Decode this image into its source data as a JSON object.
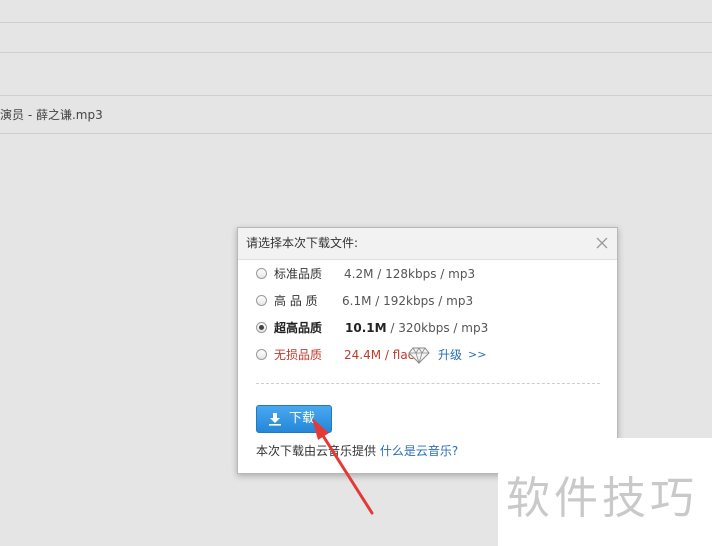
{
  "background": {
    "file_name": "演员 - 薛之谦.mp3"
  },
  "dialog": {
    "title": "请选择本次下载文件:",
    "options": [
      {
        "name": "标准品质",
        "size": "4.2M",
        "detail": "/ 128kbps / mp3",
        "checked": false
      },
      {
        "name": "高 品 质",
        "size": "6.1M",
        "detail": "/ 192kbps / mp3",
        "checked": false
      },
      {
        "name": "超高品质",
        "size": "10.1M",
        "detail": "/ 320kbps / mp3",
        "checked": true
      },
      {
        "name": "无损品质",
        "size": "24.4M",
        "detail": "/ flac",
        "checked": false
      }
    ],
    "upgrade_label": "升级",
    "upgrade_arrow": ">>",
    "download_label": "下载",
    "footer_text": "本次下载由云音乐提供",
    "footer_link": "什么是云音乐?"
  },
  "watermark": {
    "text": "软件技巧"
  },
  "colors": {
    "accent_blue": "#2487d8",
    "link_blue": "#2a6eb8",
    "lossless_red": "#c0392b",
    "arrow_red": "#e53935"
  },
  "icons": {
    "close": "close-icon",
    "diamond": "diamond-icon",
    "download": "download-icon"
  }
}
